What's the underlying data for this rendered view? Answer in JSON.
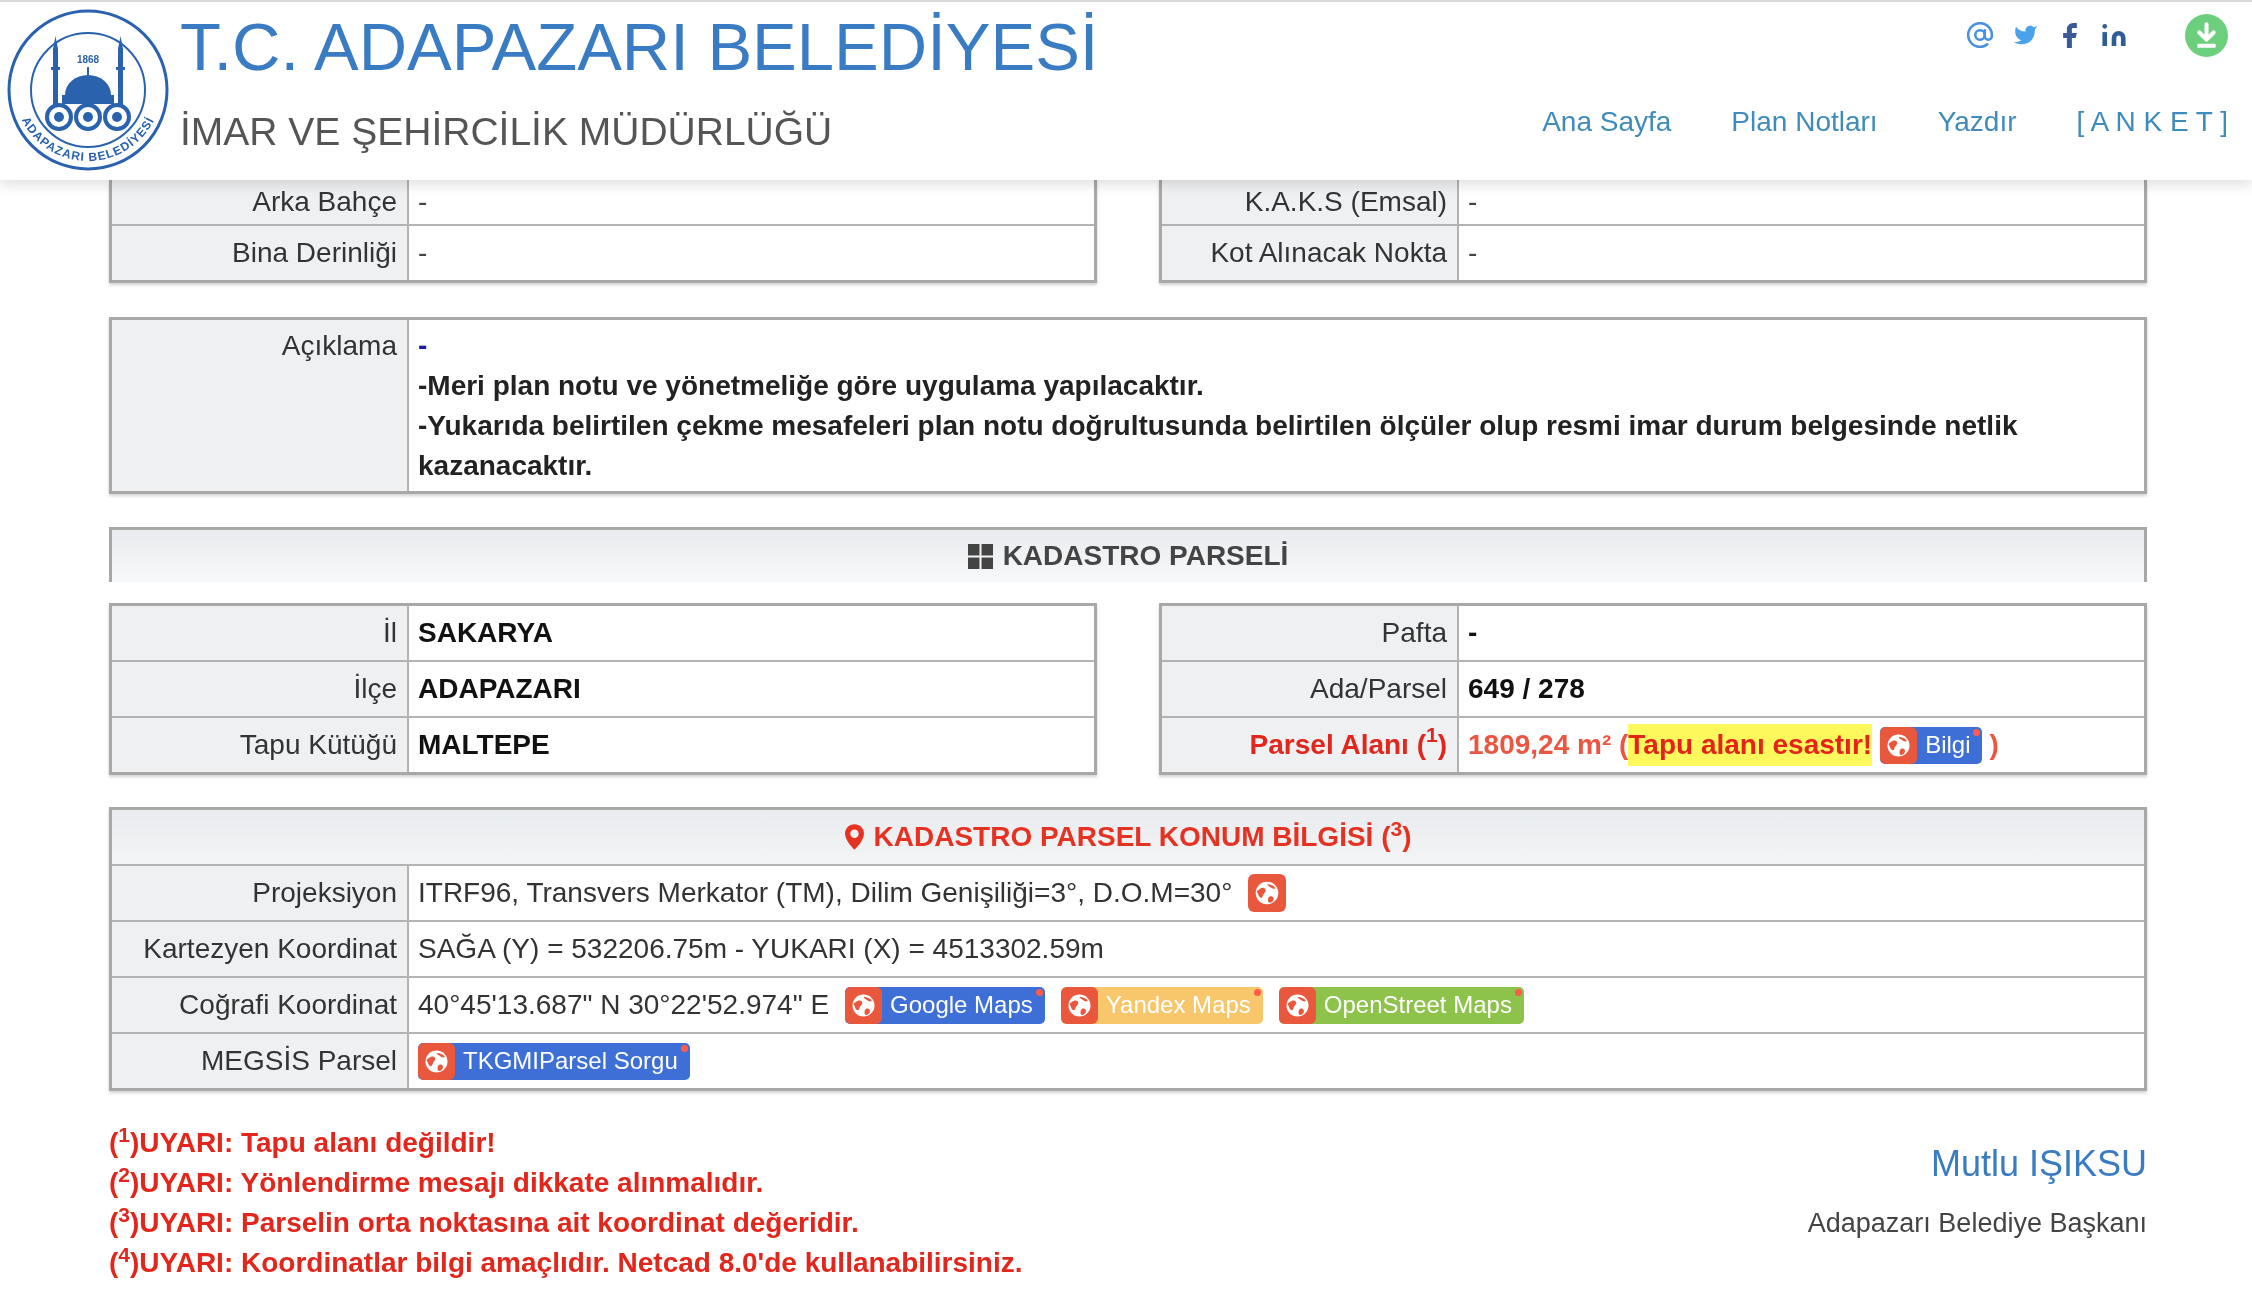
{
  "header": {
    "emblem_year": "1868",
    "emblem_ring_text": "ADAPAZARI BELEDİYESİ",
    "title": "T.C. ADAPAZARI BELEDİYESİ",
    "subtitle": "İMAR VE ŞEHİRCİLİK MÜDÜRLÜĞÜ",
    "nav": [
      "Ana Sayfa",
      "Plan Notları",
      "Yazdır",
      "[ A N K E T ]"
    ]
  },
  "building_rules": {
    "rows": [
      {
        "left": {
          "label": "Arka Bahçe",
          "value": "-"
        },
        "right": {
          "label": "K.A.K.S (Emsal)",
          "value": "-"
        }
      },
      {
        "left": {
          "label": "Bina Derinliği",
          "value": "-"
        },
        "right": {
          "label": "Kot Alınacak Nokta",
          "value": "-"
        }
      }
    ]
  },
  "description": {
    "label": "Açıklama",
    "lines": [
      {
        "kind": "dash",
        "text": "-"
      },
      {
        "kind": "note",
        "text": "-Meri plan notu ve yönetmeliğe göre uygulama yapılacaktır."
      },
      {
        "kind": "note",
        "text": "-Yukarıda belirtilen çekme mesafeleri plan notu doğrultusunda belirtilen ölçüler olup resmi imar durum belgesinde netlik kazanacaktır."
      }
    ]
  },
  "cadastral_parcel": {
    "title": "KADASTRO PARSELİ",
    "rows": [
      {
        "left": {
          "label": "İl",
          "value": "SAKARYA"
        },
        "right": {
          "kind": "plain",
          "label": "Pafta",
          "value": "-"
        }
      },
      {
        "left": {
          "label": "İlçe",
          "value": "ADAPAZARI"
        },
        "right": {
          "kind": "plain",
          "label": "Ada/Parsel",
          "value": "649 / 278"
        }
      },
      {
        "left": {
          "label": "Tapu Kütüğü",
          "value": "MALTEPE"
        },
        "right": {
          "kind": "area",
          "label": "Parsel Alanı ($^{1}$)",
          "value": "1809,24 m² (",
          "highlight": "Tapu alanı esastır!",
          "button": {
            "label": "Bilgi",
            "color": "#3d6fd6"
          },
          "closing": ")"
        }
      }
    ]
  },
  "location": {
    "title": "KADASTRO PARSEL KONUM BİLGİSİ ($^{3}$)",
    "rows": [
      {
        "label": "Projeksiyon",
        "value": "ITRF96, Transvers Merkator (TM), Dilim Genişiliği=3°, D.O.M=30°",
        "links": [
          {
            "kind": "bare"
          }
        ]
      },
      {
        "label": "Kartezyen Koordinat",
        "value": "SAĞA (Y) = 532206.75m - YUKARI (X) = 4513302.59m"
      },
      {
        "label": "Coğrafi Koordinat",
        "value": "40°45'13.687\" N 30°22'52.974\" E",
        "links": [
          {
            "kind": "labeled",
            "label": "Google Maps",
            "color": "#3d6fd6"
          },
          {
            "kind": "labeled",
            "label": "Yandex Maps",
            "color": "#f8c76b"
          },
          {
            "kind": "labeled",
            "label": "OpenStreet Maps",
            "color": "#8dc24b"
          }
        ]
      },
      {
        "label": "MEGSİS Parsel",
        "links": [
          {
            "kind": "labeled",
            "label": "TKGMIParsel Sorgu",
            "color": "#3d6fd6"
          }
        ]
      }
    ]
  },
  "warnings": [
    "($^{1}$)UYARI: Tapu alanı değildir!",
    "($^{2}$)UYARI: Yönlendirme mesajı dikkate alınmalıdır.",
    "($^{3}$)UYARI: Parselin orta noktasına ait koordinat değeridir.",
    "($^{4}$)UYARI: Koordinatlar bilgi amaçlıdır. Netcad 8.0'de kullanabilirsiniz."
  ],
  "signature": {
    "name": "Mutlu IŞIKSU",
    "title": "Adapazarı Belediye Başkanı"
  }
}
